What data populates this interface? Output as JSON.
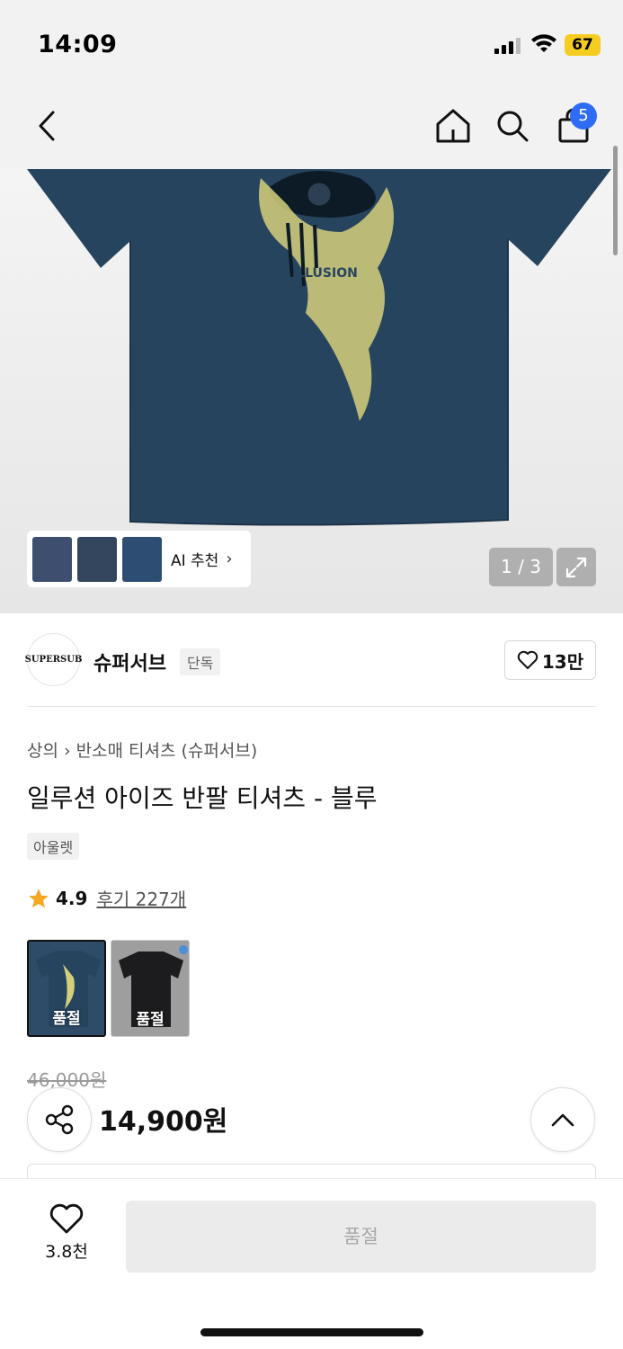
{
  "status_bar": {
    "time": "14:09",
    "battery": "67"
  },
  "nav": {
    "cart_count": "5"
  },
  "gallery": {
    "ai_label": "AI 추천",
    "page_indicator": "1 / 3"
  },
  "brand": {
    "logo_text": "SUPERSUB",
    "name": "슈퍼서브",
    "tag": "단독",
    "likes": "13만"
  },
  "product": {
    "breadcrumb": [
      "상의",
      "반소매 티셔츠 (슈퍼서브)"
    ],
    "title": "일루션 아이즈 반팔 티셔츠 - 블루",
    "tag": "아울렛",
    "rating": "4.9",
    "review_link": "후기 227개",
    "swatches": [
      {
        "label": "품절",
        "selected": true
      },
      {
        "label": "품절",
        "selected": false
      }
    ],
    "original_price": "46,000원",
    "sale_price": "14,900원"
  },
  "bottom_bar": {
    "wish_count": "3.8천",
    "buy_label": "품절"
  },
  "colors": {
    "shirt_navy": "#27445f",
    "print_yellow": "#d6cf7a",
    "badge_blue": "#2f6cf5",
    "star": "#f5a623"
  }
}
